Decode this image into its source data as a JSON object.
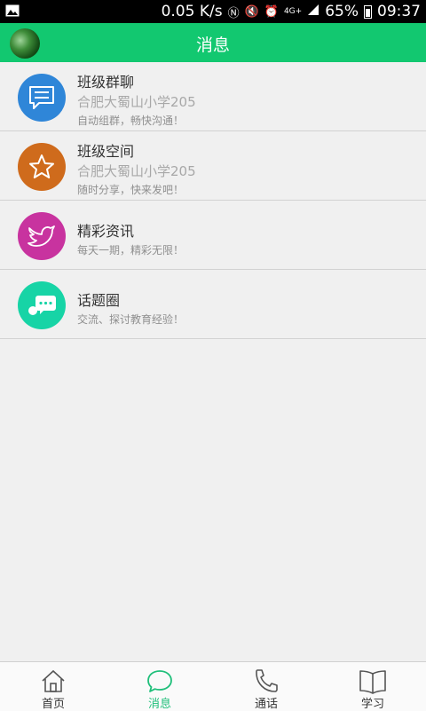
{
  "status_bar": {
    "speed": "0.05 K/s",
    "battery": "65%",
    "time": "09:37",
    "network": "4G+"
  },
  "header": {
    "title": "消息"
  },
  "items": [
    {
      "name": "班级群聊",
      "sub": "合肥大蜀山小学205",
      "desc": "自动组群，畅快沟通！",
      "icon": "chat-icon",
      "color": "#2f86d8"
    },
    {
      "name": "班级空间",
      "sub": "合肥大蜀山小学205",
      "desc": "随时分享，快来发吧！",
      "icon": "star-icon",
      "color": "#cf6b1c"
    },
    {
      "name": "精彩资讯",
      "desc": "每天一期，精彩无限！",
      "icon": "bird-icon",
      "color": "#c8339f"
    },
    {
      "name": "话题圈",
      "desc": "交流、探讨教育经验！",
      "icon": "bubbles-icon",
      "color": "#17d4a6"
    }
  ],
  "tabs": [
    {
      "label": "首页",
      "icon": "home-icon",
      "active": false
    },
    {
      "label": "消息",
      "icon": "message-icon",
      "active": true
    },
    {
      "label": "通话",
      "icon": "phone-icon",
      "active": false
    },
    {
      "label": "学习",
      "icon": "book-icon",
      "active": false
    }
  ],
  "colors": {
    "accent": "#12c870",
    "active_tab": "#1fbf7a"
  }
}
